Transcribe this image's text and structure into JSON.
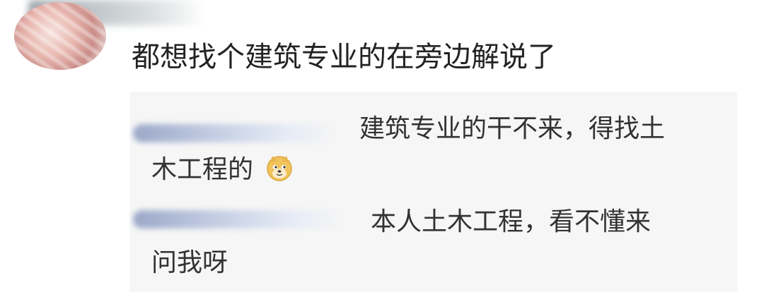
{
  "comment": {
    "text": "都想找个建筑专业的在旁边解说了"
  },
  "replies": [
    {
      "line1": "建筑专业的干不来，得找土",
      "line2": "木工程的",
      "emoji": "doge-icon"
    },
    {
      "line1": "本人土木工程，看不懂来",
      "line2": "问我呀"
    }
  ],
  "colors": {
    "reply_background": "#f6f6f6",
    "text_primary": "#222222",
    "text_reply": "#333333"
  }
}
